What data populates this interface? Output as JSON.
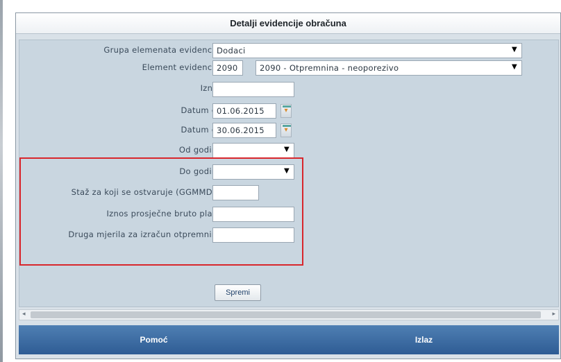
{
  "dialog": {
    "title": "Detalji evidencije obračuna"
  },
  "form": {
    "group": {
      "label": "Grupa elemenata evidencije:",
      "value": "Dodaci"
    },
    "element": {
      "label": "Element evidencije:",
      "code": "2090",
      "value": "2090 - Otpremnina - neoporezivo"
    },
    "amount": {
      "label": "Iznos:",
      "value": ""
    },
    "date_from": {
      "label": "Datum od:",
      "value": "01.06.2015"
    },
    "date_to": {
      "label": "Datum do:",
      "value": "30.06.2015"
    },
    "from_year": {
      "label": "Od godine:",
      "value": ""
    },
    "to_year": {
      "label": "Do godine:",
      "value": ""
    },
    "tenure": {
      "label": "Staž za koji se ostvaruje (GGMMDD):",
      "value": ""
    },
    "avg_salary": {
      "label": "Iznos prosječne bruto plaće:",
      "value": ""
    },
    "other_criteria": {
      "label": "Druga mjerila za izračun otpremnine:",
      "value": ""
    },
    "save_label": "Spremi"
  },
  "footer": {
    "help_label": "Pomoć",
    "exit_label": "Izlaz"
  },
  "icons": {
    "dropdown": "▼",
    "calendar": "calendar-icon",
    "scroll_left": "◂",
    "scroll_right": "▸"
  },
  "colors": {
    "highlight": "#d8262c",
    "footer": "#3d6ca3",
    "panel": "#c9d6e0"
  }
}
